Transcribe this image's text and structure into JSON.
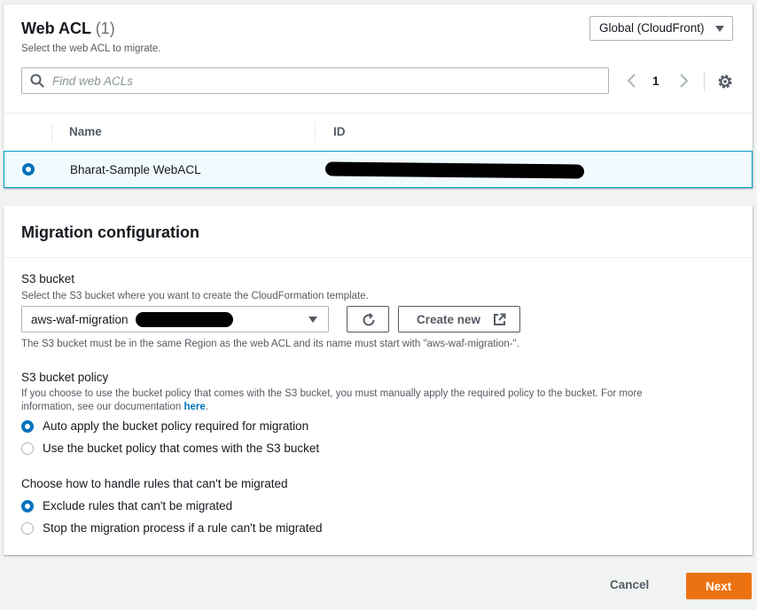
{
  "acl_panel": {
    "title": "Web ACL",
    "count": "(1)",
    "description": "Select the web ACL to migrate.",
    "region": "Global (CloudFront)",
    "search_placeholder": "Find web ACLs",
    "page": "1",
    "columns": [
      "Name",
      "ID"
    ],
    "rows": [
      {
        "name": "Bharat-Sample WebACL",
        "id_redacted": true,
        "selected": true
      }
    ]
  },
  "migration": {
    "title": "Migration configuration",
    "s3": {
      "label": "S3 bucket",
      "description": "Select the S3 bucket where you want to create the CloudFormation template.",
      "selected_value": "aws-waf-migration",
      "create_label": "Create new",
      "hint": "The S3 bucket must be in the same Region as the web ACL and its name must start with \"aws-waf-migration-\"."
    },
    "policy": {
      "label": "S3 bucket policy",
      "description_1": "If you choose to use the bucket policy that comes with the S3 bucket, you must manually apply the required policy to the bucket. For more",
      "description_2": "information, see our documentation",
      "link": "here",
      "options": [
        {
          "label": "Auto apply the bucket policy required for migration",
          "checked": true
        },
        {
          "label": "Use the bucket policy that comes with the S3 bucket",
          "checked": false
        }
      ]
    },
    "rules": {
      "label": "Choose how to handle rules that can't be migrated",
      "options": [
        {
          "label": "Exclude rules that can't be migrated",
          "checked": true
        },
        {
          "label": "Stop the migration process if a rule can't be migrated",
          "checked": false
        }
      ]
    }
  },
  "footer": {
    "cancel": "Cancel",
    "next": "Next"
  },
  "colors": {
    "primary": "#ec7211",
    "link": "#0073bb",
    "selected_row": "#f1faff"
  },
  "icons": [
    "search-icon",
    "chevron-left-icon",
    "chevron-right-icon",
    "gear-icon",
    "refresh-icon",
    "external-link-icon"
  ]
}
